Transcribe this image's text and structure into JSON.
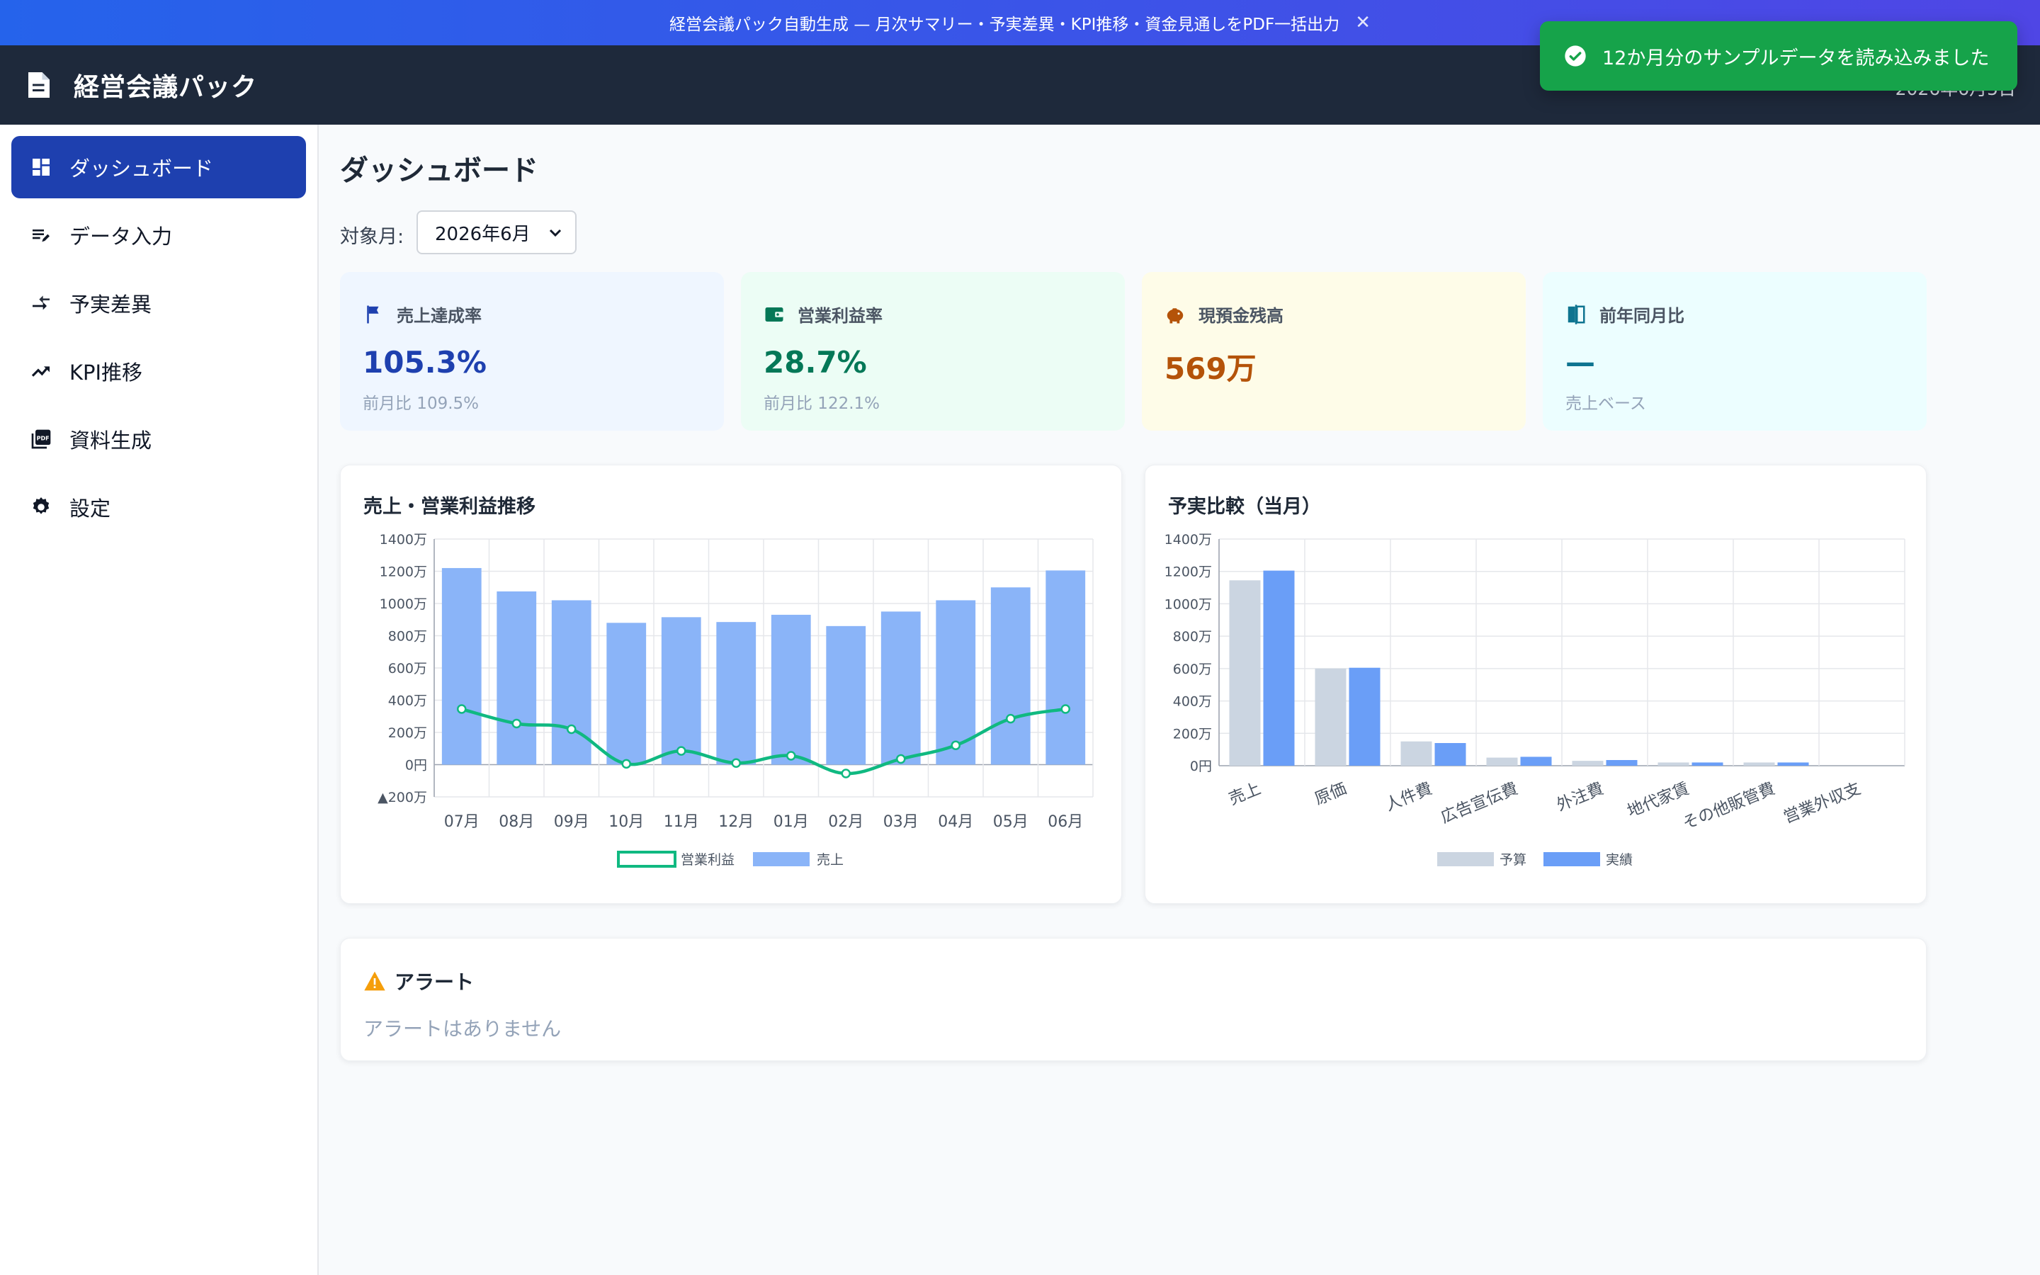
{
  "banner": {
    "text": "経営会議パック自動生成 — 月次サマリー・予実差異・KPI推移・資金見通しをPDF一括出力",
    "close": "✕"
  },
  "header": {
    "title": "経営会議パック",
    "date": "2026年6月5日"
  },
  "toast": {
    "text": "12か月分のサンプルデータを読み込みました",
    "color": "#16a34a"
  },
  "sidebar": {
    "items": [
      {
        "label": "ダッシュボード",
        "icon": "dashboard-icon",
        "active": true
      },
      {
        "label": "データ入力",
        "icon": "edit-list-icon"
      },
      {
        "label": "予実差異",
        "icon": "compare-arrows-icon"
      },
      {
        "label": "KPI推移",
        "icon": "trending-up-icon"
      },
      {
        "label": "資料生成",
        "icon": "pdf-icon"
      },
      {
        "label": "設定",
        "icon": "gear-icon"
      }
    ]
  },
  "main": {
    "title": "ダッシュボード",
    "month_label": "対象月:",
    "month_value": "2026年6月"
  },
  "kpis": [
    {
      "label": "売上達成率",
      "value": "105.3%",
      "sub": "前月比 109.5%",
      "icon": "flag-icon",
      "color": "#1e40af",
      "bg": "#eff6ff"
    },
    {
      "label": "営業利益率",
      "value": "28.7%",
      "sub": "前月比 122.1%",
      "icon": "wallet-icon",
      "color": "#047857",
      "bg": "#ecfdf5"
    },
    {
      "label": "現預金残高",
      "value": "569万",
      "sub": "",
      "icon": "piggy-bank-icon",
      "color": "#b45309",
      "bg": "#fefce8"
    },
    {
      "label": "前年同月比",
      "value": "—",
      "sub": "売上ベース",
      "icon": "compare-icon",
      "color": "#0e7490",
      "bg": "#ecfeff"
    }
  ],
  "charts": {
    "trend_title": "売上・営業利益推移",
    "budget_title": "予実比較（当月）"
  },
  "chart_data": [
    {
      "type": "bar",
      "title": "売上・営業利益推移",
      "categories": [
        "07月",
        "08月",
        "09月",
        "10月",
        "11月",
        "12月",
        "01月",
        "02月",
        "03月",
        "04月",
        "05月",
        "06月"
      ],
      "series": [
        {
          "name": "営業利益",
          "type": "line",
          "color": "#10b981",
          "values": [
            345,
            255,
            220,
            5,
            85,
            10,
            55,
            -55,
            35,
            120,
            285,
            345
          ]
        },
        {
          "name": "売上",
          "type": "bar",
          "color": "#8ab4f8",
          "values": [
            1220,
            1075,
            1020,
            880,
            915,
            885,
            930,
            860,
            950,
            1020,
            1100,
            1205
          ]
        }
      ],
      "yticks": [
        "1400万",
        "1200万",
        "1000万",
        "800万",
        "600万",
        "400万",
        "200万",
        "0円",
        "▲200万"
      ],
      "ylim": [
        -200,
        1400
      ],
      "grid": true,
      "legend": "bottom"
    },
    {
      "type": "bar",
      "title": "予実比較（当月）",
      "categories": [
        "売上",
        "原価",
        "人件費",
        "広告宣伝費",
        "外注費",
        "地代家賃",
        "その他販管費",
        "営業外収支"
      ],
      "series": [
        {
          "name": "予算",
          "color": "#cbd5e1",
          "values": [
            1145,
            600,
            150,
            50,
            30,
            20,
            20,
            0
          ]
        },
        {
          "name": "実績",
          "color": "#6a9ef7",
          "values": [
            1205,
            605,
            140,
            55,
            35,
            20,
            20,
            0
          ]
        }
      ],
      "yticks": [
        "1400万",
        "1200万",
        "1000万",
        "800万",
        "600万",
        "400万",
        "200万",
        "0円"
      ],
      "ylim": [
        0,
        1400
      ],
      "grid": true,
      "legend": "bottom"
    }
  ],
  "alerts": {
    "title": "アラート",
    "empty_text": "アラートはありません",
    "icon": "warning-icon"
  }
}
